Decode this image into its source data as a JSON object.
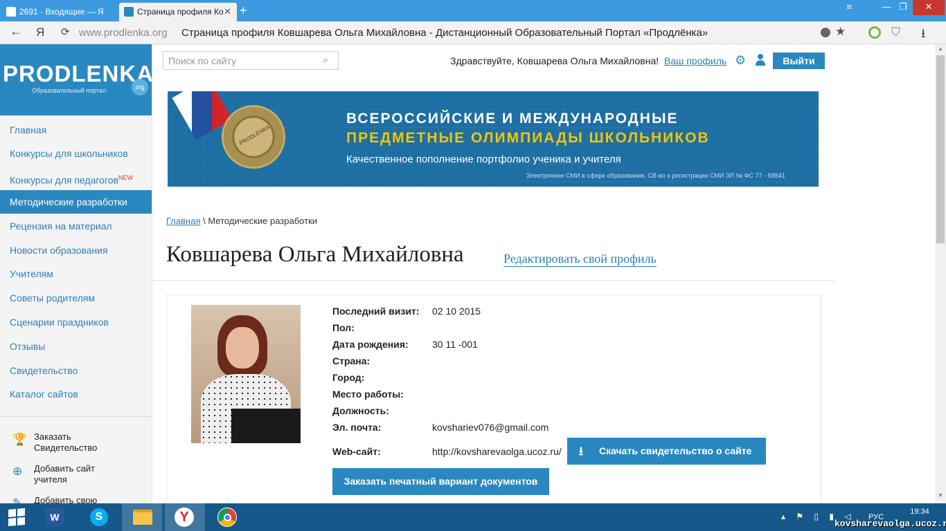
{
  "browser": {
    "tabs": [
      {
        "label": "2691 · Входящие — Я"
      },
      {
        "label": "Страница профиля Ко",
        "close": "✕"
      }
    ],
    "new_tab": "+",
    "window_buttons": {
      "menu": "≡",
      "minimize": "—",
      "maximize": "❐",
      "close": "✕"
    },
    "nav_back": "←",
    "nav_ya": "Я",
    "reload": "⟳",
    "url_host": "www.prodlenka.org",
    "url_title": "Страница профиля Ковшарева Ольга Михайловна - Дистанционный Образовательный Портал «Продлёнка»",
    "star": "★",
    "download": "⭳",
    "shield": "⛉"
  },
  "logo": {
    "text": "PRODLENKA",
    "subtitle": "Образовательный портал",
    "badge": "org"
  },
  "sidebar": {
    "items": [
      {
        "label": "Главная"
      },
      {
        "label": "Конкурсы для школьников"
      },
      {
        "label": "Конкурсы для педагогов",
        "badge": "NEW"
      },
      {
        "label": "Методические разработки",
        "active": true
      },
      {
        "label": "Рецензия на материал"
      },
      {
        "label": "Новости образования"
      },
      {
        "label": "Учителям"
      },
      {
        "label": "Советы родителям"
      },
      {
        "label": "Сценарии праздников"
      },
      {
        "label": "Отзывы"
      },
      {
        "label": "Свидетельство"
      },
      {
        "label": "Каталог сайтов"
      }
    ],
    "actions": [
      {
        "icon": "🏆",
        "line1": "Заказать",
        "line2": "Свидетельство"
      },
      {
        "icon": "⊕",
        "line1": "Добавить сайт",
        "line2": "учителя"
      },
      {
        "icon": "✎",
        "line1": "Добавить свою",
        "line2": ""
      }
    ]
  },
  "header": {
    "search_placeholder": "Поиск по сайту",
    "greeting": "Здравствуйте, Ковшарева Ольга Михайловна!",
    "profile_link": "Ваш профиль",
    "gear": "⚙",
    "logout": "Выйти",
    "search_glyph": "⌕"
  },
  "banner": {
    "line1": "ВСЕРОССИЙСКИЕ И МЕЖДУНАРОДНЫЕ",
    "line2": "ПРЕДМЕТНЫЕ ОЛИМПИАДЫ ШКОЛЬНИКОВ",
    "line3": "Качественное пополнение портфолио ученика и учителя",
    "small": "Электронное СМИ в сфере образования, СВ-во о регистрации СМИ ЭЛ № ФС 77 - 58841",
    "medal_text": "PRODLENKA"
  },
  "breadcrumb": {
    "home": "Главная",
    "separator": " \\ ",
    "current": "Методические разработки"
  },
  "profile": {
    "name": "Ковшарева Ольга Михайловна",
    "edit_link": "Редактировать свой профиль",
    "fields": [
      {
        "label": "Последний визит:",
        "value": "02 10 2015"
      },
      {
        "label": "Пол:",
        "value": ""
      },
      {
        "label": "Дата рождения:",
        "value": "30 11 -001"
      },
      {
        "label": "Страна:",
        "value": ""
      },
      {
        "label": "Город:",
        "value": ""
      },
      {
        "label": "Место работы:",
        "value": ""
      },
      {
        "label": "Должность:",
        "value": ""
      },
      {
        "label": "Эл. почта:",
        "value": "kovshariev076@gmail.com"
      },
      {
        "label": "Web-сайт:",
        "value": "http://kovsharevaolga.ucoz.ru/"
      }
    ],
    "cert_button": "Скачать свидетельство о сайте",
    "cert_icon": "⭳",
    "order_button": "Заказать печатный вариант документов"
  },
  "scrollbar": {
    "up": "▲",
    "down": "▼"
  },
  "taskbar": {
    "word": "W",
    "skype": "S",
    "yabrowser": "Y",
    "tray_icons": "▴ ⚑ ▯ ▮ ◁",
    "lang": "РУС",
    "time": "19:34"
  },
  "watermark": "kovsharevaolga.ucoz.ru"
}
